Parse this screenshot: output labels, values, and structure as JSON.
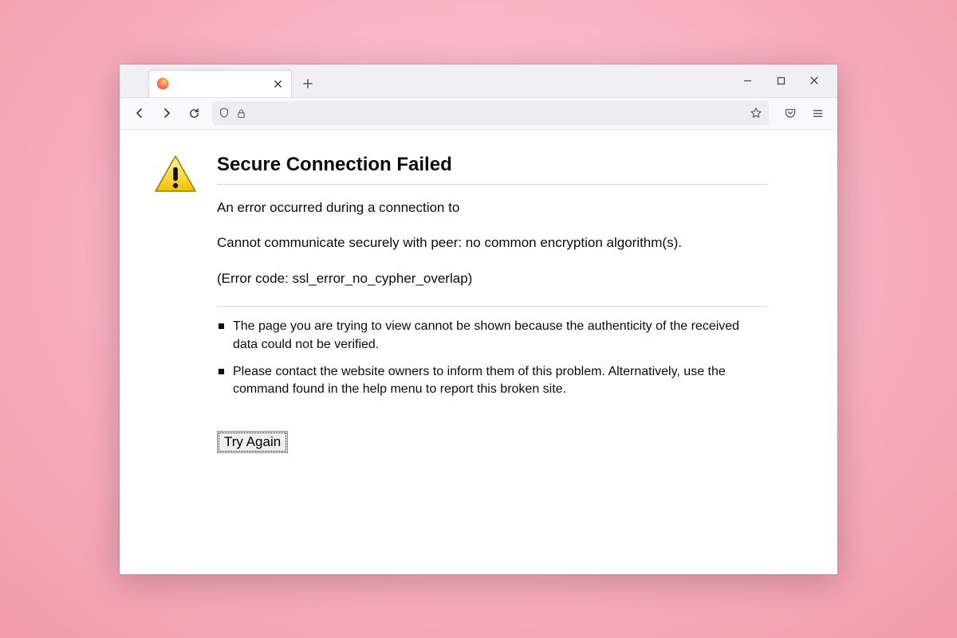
{
  "tab": {
    "title": ""
  },
  "error": {
    "heading": "Secure Connection Failed",
    "line1": "An error occurred during a connection to",
    "line2": "Cannot communicate securely with peer: no common encryption algorithm(s).",
    "line3": "(Error code: ssl_error_no_cypher_overlap)",
    "bullets": [
      "The page you are trying to view cannot be shown because the authenticity of the received data could not be verified.",
      "Please contact the website owners to inform them of this problem. Alternatively, use the command found in the help menu to report this broken site."
    ],
    "try_again": "Try Again"
  },
  "urlbar": {
    "value": ""
  }
}
